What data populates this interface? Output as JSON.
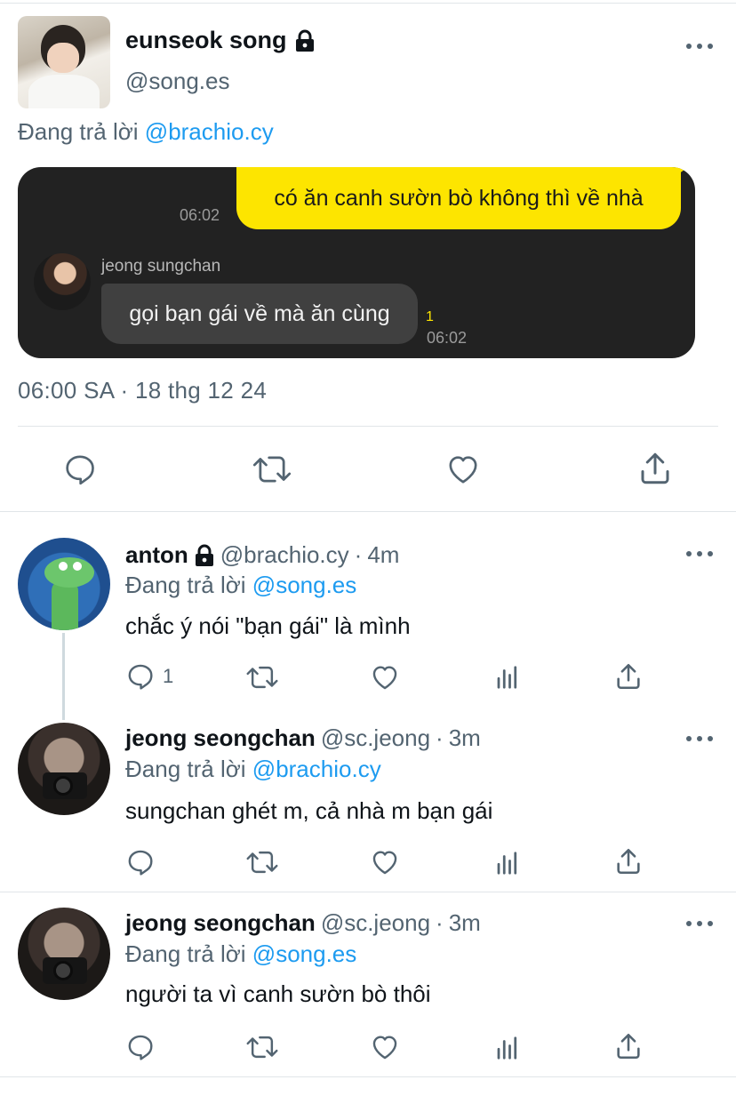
{
  "main_tweet": {
    "display_name": "eunseok song",
    "handle": "@song.es",
    "reply_prefix": "Đang trả lời",
    "reply_mention": "@brachio.cy",
    "timestamp": "06:00 SA · 18 thg 12 24",
    "chat": {
      "my_message": "có ăn canh sườn bò không thì về nhà",
      "my_time": "06:02",
      "sender_name": "jeong sungchan",
      "their_message": "gọi bạn gái về mà ăn cùng",
      "unread_count": "1",
      "their_time": "06:02"
    }
  },
  "replies": [
    {
      "display_name": "anton",
      "handle": "@brachio.cy",
      "time": "4m",
      "reply_prefix": "Đang trả lời",
      "reply_mention": "@song.es",
      "text": "chắc ý nói \"bạn gái\" là mình",
      "reply_count": "1",
      "locked": true
    },
    {
      "display_name": "jeong seongchan",
      "handle": "@sc.jeong",
      "time": "3m",
      "reply_prefix": "Đang trả lời",
      "reply_mention": "@brachio.cy",
      "text": "sungchan ghét m, cả nhà m bạn gái",
      "reply_count": "",
      "locked": false
    },
    {
      "display_name": "jeong seongchan",
      "handle": "@sc.jeong",
      "time": "3m",
      "reply_prefix": "Đang trả lời",
      "reply_mention": "@song.es",
      "text": "người ta vì canh sườn bò thôi",
      "reply_count": "",
      "locked": false
    }
  ],
  "separator": "·",
  "icons": [
    "lock-icon",
    "more-icon",
    "reply-icon",
    "retweet-icon",
    "like-icon",
    "views-icon",
    "share-icon"
  ],
  "colors": {
    "link": "#1d9bf0",
    "muted": "#536471",
    "chat_bg": "#222222",
    "chat_mine": "#fde500"
  }
}
